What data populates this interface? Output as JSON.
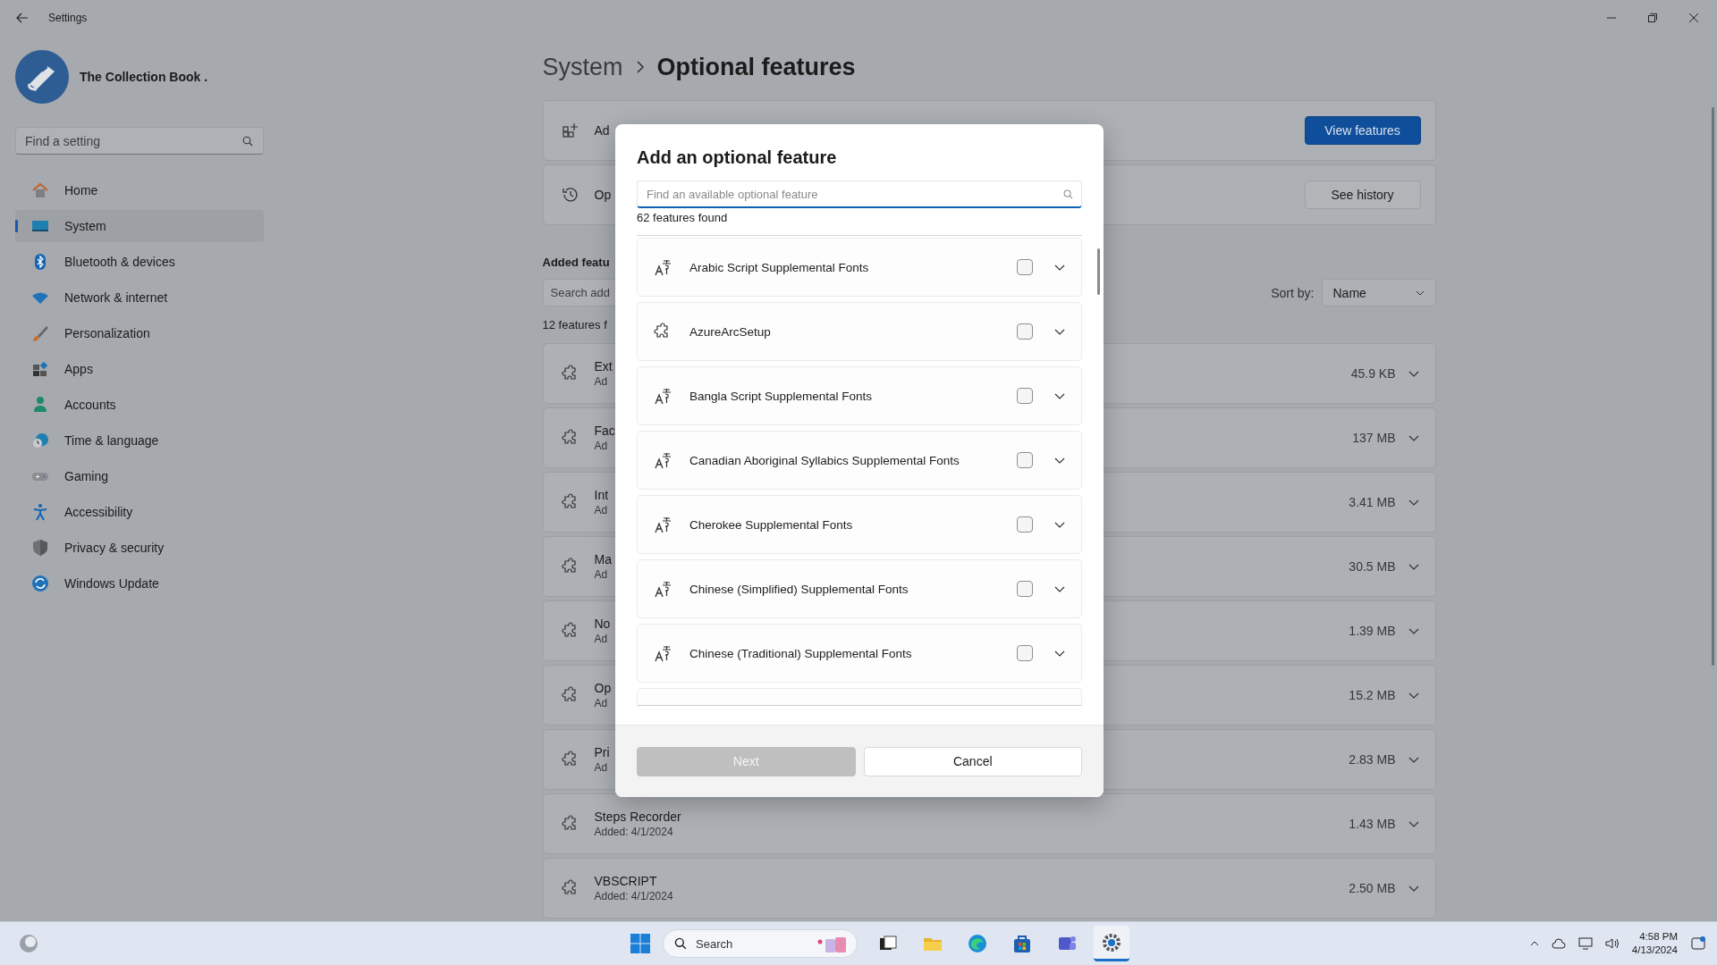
{
  "window": {
    "title": "Settings"
  },
  "account": {
    "name": "The Collection Book ."
  },
  "search": {
    "placeholder": "Find a setting"
  },
  "nav": [
    {
      "label": "Home",
      "selected": false
    },
    {
      "label": "System",
      "selected": true
    },
    {
      "label": "Bluetooth & devices",
      "selected": false
    },
    {
      "label": "Network & internet",
      "selected": false
    },
    {
      "label": "Personalization",
      "selected": false
    },
    {
      "label": "Apps",
      "selected": false
    },
    {
      "label": "Accounts",
      "selected": false
    },
    {
      "label": "Time & language",
      "selected": false
    },
    {
      "label": "Gaming",
      "selected": false
    },
    {
      "label": "Accessibility",
      "selected": false
    },
    {
      "label": "Privacy & security",
      "selected": false
    },
    {
      "label": "Windows Update",
      "selected": false
    }
  ],
  "breadcrumb": [
    "System",
    "Optional features"
  ],
  "cards": [
    {
      "label": "Ad",
      "button": "View features",
      "kind": "primary"
    },
    {
      "label": "Op",
      "button": "See history",
      "kind": "standard"
    }
  ],
  "added": {
    "heading": "Added featu",
    "search_placeholder": "Search add",
    "sort_label": "Sort by:",
    "sort_value": "Name",
    "count": "12 features f",
    "rows": [
      {
        "name": "Ext",
        "detail": "Ad",
        "size": "45.9 KB"
      },
      {
        "name": "Fac",
        "detail": "Ad",
        "size": "137 MB"
      },
      {
        "name": "Int",
        "detail": "Ad",
        "size": "3.41 MB"
      },
      {
        "name": "Ma",
        "detail": "Ad",
        "size": "30.5 MB"
      },
      {
        "name": "No",
        "detail": "Ad",
        "size": "1.39 MB"
      },
      {
        "name": "Op",
        "detail": "Ad",
        "size": "15.2 MB"
      },
      {
        "name": "Pri",
        "detail": "Ad",
        "size": "2.83 MB"
      },
      {
        "name": "Steps Recorder",
        "detail": "Added: 4/1/2024",
        "size": "1.43 MB"
      },
      {
        "name": "VBSCRIPT",
        "detail": "Added: 4/1/2024",
        "size": "2.50 MB"
      }
    ]
  },
  "dialog": {
    "title": "Add an optional feature",
    "search_placeholder": "Find an available optional feature",
    "count": "62 features found",
    "items": [
      {
        "name": "Arabic Script Supplemental Fonts",
        "kind": "font",
        "checked": false
      },
      {
        "name": "AzureArcSetup",
        "kind": "package",
        "checked": false
      },
      {
        "name": "Bangla Script Supplemental Fonts",
        "kind": "font",
        "checked": false
      },
      {
        "name": "Canadian Aboriginal Syllabics Supplemental Fonts",
        "kind": "font",
        "checked": false
      },
      {
        "name": "Cherokee Supplemental Fonts",
        "kind": "font",
        "checked": false
      },
      {
        "name": "Chinese (Simplified) Supplemental Fonts",
        "kind": "font",
        "checked": false
      },
      {
        "name": "Chinese (Traditional) Supplemental Fonts",
        "kind": "font",
        "checked": false
      }
    ],
    "buttons": [
      {
        "label": "Next",
        "disabled": true
      },
      {
        "label": "Cancel",
        "disabled": false
      }
    ]
  },
  "taskbar": {
    "search": "Search",
    "apps": [
      {
        "selected": false
      },
      {
        "selected": false
      },
      {
        "selected": false
      },
      {
        "selected": false
      },
      {
        "selected": false
      },
      {
        "selected": true
      }
    ],
    "time": "4:58 PM",
    "date": "4/13/2024"
  }
}
